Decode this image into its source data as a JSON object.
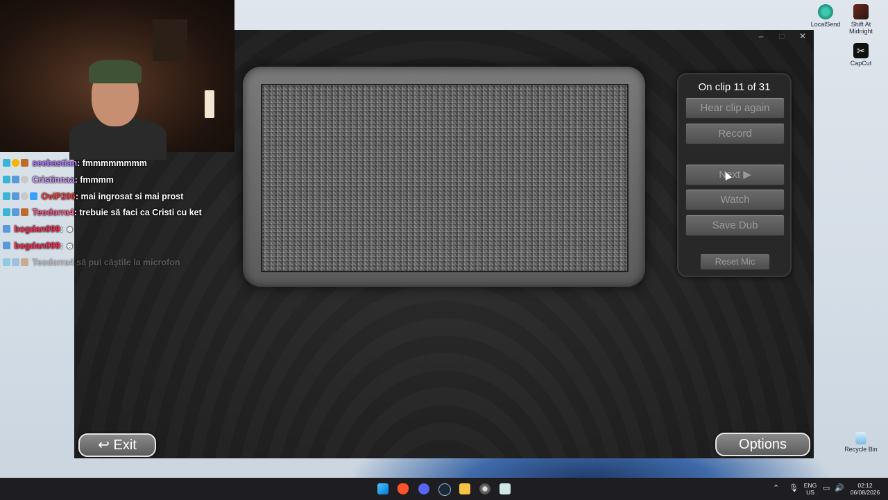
{
  "desktop": {
    "icons": [
      {
        "label": "LocalSend",
        "icon": "localsend-icon"
      },
      {
        "label": "Shift At Midnight",
        "icon": "game-shortcut-icon"
      },
      {
        "label": "CapCut",
        "icon": "capcut-icon"
      },
      {
        "label": "Recycle Bin",
        "icon": "recycle-bin-icon"
      }
    ]
  },
  "window": {
    "minimize": "–",
    "maximize": "□",
    "close": "✕"
  },
  "panel": {
    "clip_status": "On clip 11 of 31",
    "hear_again": "Hear clip again",
    "record": "Record",
    "next": "Next ▶",
    "watch": "Watch",
    "save_dub": "Save Dub",
    "reset_mic": "Reset Mic"
  },
  "footer": {
    "exit": "↩ Exit",
    "options": "Options"
  },
  "chat": [
    {
      "user": "seebastian",
      "text": "fmmmmmmmm",
      "color": "#b57cff"
    },
    {
      "user": "Cristinnaa",
      "text": "fmmmm",
      "color": "#d69cff"
    },
    {
      "user": "OviP206",
      "text": "mai ingrosat si mai prost",
      "color": "#ff3b3b"
    },
    {
      "user": "Teodorra4",
      "text": "trebuie să faci ca Cristi cu ket",
      "color": "#ff5c8a"
    },
    {
      "user": "bogdan099",
      "text": "",
      "color": "#ff2d55"
    },
    {
      "user": "bogdan099",
      "text": "",
      "color": "#ff2d55"
    },
    {
      "user": "Teodorra4",
      "text": "să pui căștile la microfon",
      "color": "#8a8a8a"
    }
  ],
  "taskbar": {
    "lang_top": "ENG",
    "lang_bottom": "US",
    "time": "02:12",
    "date": "06/08/2026"
  }
}
